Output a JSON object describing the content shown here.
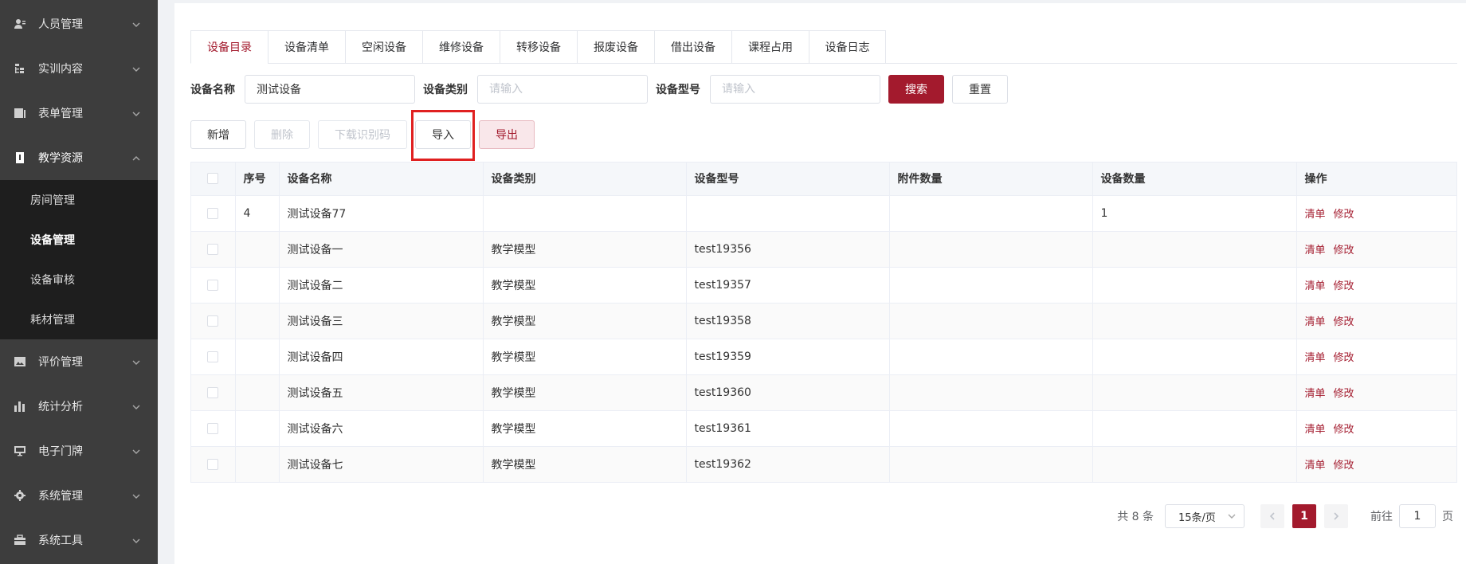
{
  "sidebar": {
    "menu": [
      {
        "label": "人员管理",
        "icon": "users-icon"
      },
      {
        "label": "实训内容",
        "icon": "tree-icon"
      },
      {
        "label": "表单管理",
        "icon": "form-icon"
      },
      {
        "label": "教学资源",
        "icon": "book-icon"
      },
      {
        "label": "评价管理",
        "icon": "image-icon"
      },
      {
        "label": "统计分析",
        "icon": "bar-chart-icon"
      },
      {
        "label": "电子门牌",
        "icon": "monitor-icon"
      },
      {
        "label": "系统管理",
        "icon": "gear-icon"
      },
      {
        "label": "系统工具",
        "icon": "toolbox-icon"
      }
    ],
    "submenu": [
      {
        "label": "房间管理"
      },
      {
        "label": "设备管理"
      },
      {
        "label": "设备审核"
      },
      {
        "label": "耗材管理"
      }
    ]
  },
  "tabs": [
    {
      "label": "设备目录"
    },
    {
      "label": "设备清单"
    },
    {
      "label": "空闲设备"
    },
    {
      "label": "维修设备"
    },
    {
      "label": "转移设备"
    },
    {
      "label": "报废设备"
    },
    {
      "label": "借出设备"
    },
    {
      "label": "课程占用"
    },
    {
      "label": "设备日志"
    }
  ],
  "search": {
    "name_label": "设备名称",
    "name_value": "测试设备",
    "type_label": "设备类别",
    "type_placeholder": "请输入",
    "model_label": "设备型号",
    "model_placeholder": "请输入",
    "search_btn": "搜索",
    "reset_btn": "重置"
  },
  "actions": {
    "add": "新增",
    "delete": "删除",
    "download_code": "下载识别码",
    "import": "导入",
    "export": "导出"
  },
  "table": {
    "headers": [
      "序号",
      "设备名称",
      "设备类别",
      "设备型号",
      "附件数量",
      "设备数量",
      "操作"
    ],
    "rows": [
      {
        "index": "4",
        "name": "测试设备77",
        "type": "",
        "model": "",
        "attach": "",
        "qty": "1"
      },
      {
        "index": "",
        "name": "测试设备一",
        "type": "教学模型",
        "model": "test19356",
        "attach": "",
        "qty": ""
      },
      {
        "index": "",
        "name": "测试设备二",
        "type": "教学模型",
        "model": "test19357",
        "attach": "",
        "qty": ""
      },
      {
        "index": "",
        "name": "测试设备三",
        "type": "教学模型",
        "model": "test19358",
        "attach": "",
        "qty": ""
      },
      {
        "index": "",
        "name": "测试设备四",
        "type": "教学模型",
        "model": "test19359",
        "attach": "",
        "qty": ""
      },
      {
        "index": "",
        "name": "测试设备五",
        "type": "教学模型",
        "model": "test19360",
        "attach": "",
        "qty": ""
      },
      {
        "index": "",
        "name": "测试设备六",
        "type": "教学模型",
        "model": "test19361",
        "attach": "",
        "qty": ""
      },
      {
        "index": "",
        "name": "测试设备七",
        "type": "教学模型",
        "model": "test19362",
        "attach": "",
        "qty": ""
      }
    ],
    "op_list": "清单",
    "op_edit": "修改"
  },
  "pagination": {
    "total": "共 8 条",
    "page_size": "15条/页",
    "current_page": "1",
    "goto_label": "前往",
    "goto_value": "1",
    "page_suffix": "页"
  },
  "colors": {
    "accent": "#a31a2d",
    "sidebar_bg": "#3d3d3d",
    "submenu_bg": "#1e1e1e"
  }
}
